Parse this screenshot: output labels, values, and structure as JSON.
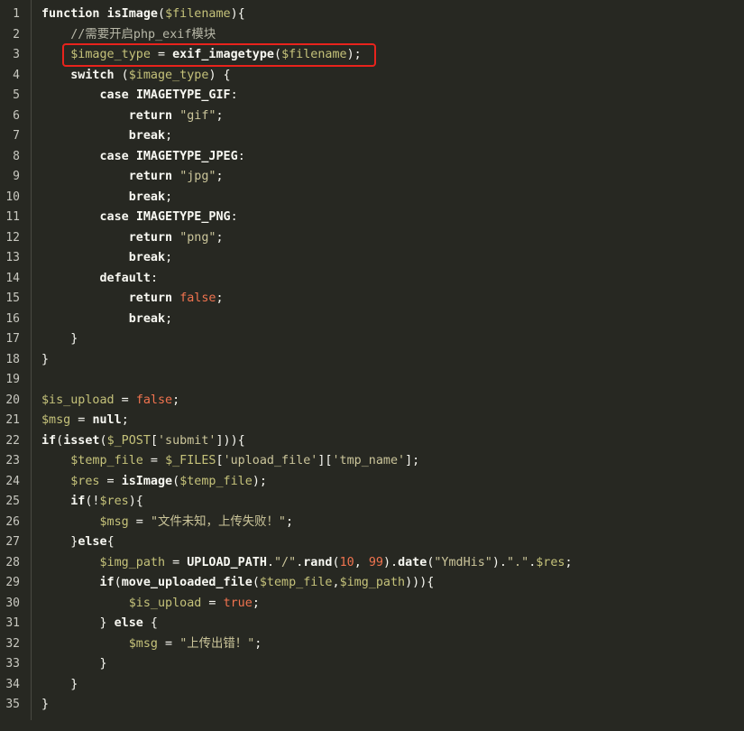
{
  "editor": {
    "highlight_color": "#e8231c",
    "background_color": "#272822",
    "lines": [
      {
        "n": "1",
        "tokens": [
          [
            "kw",
            "function "
          ],
          [
            "fn",
            "isImage"
          ],
          [
            "punc",
            "("
          ],
          [
            "var",
            "$filename"
          ],
          [
            "punc",
            "){"
          ]
        ]
      },
      {
        "n": "2",
        "tokens": [
          [
            "com",
            "    //需要开启php_exif模块"
          ]
        ]
      },
      {
        "n": "3",
        "tokens": [
          [
            "var",
            "    $image_type"
          ],
          [
            "op",
            " = "
          ],
          [
            "fn",
            "exif_imagetype"
          ],
          [
            "punc",
            "("
          ],
          [
            "var",
            "$filename"
          ],
          [
            "punc",
            ");"
          ]
        ]
      },
      {
        "n": "4",
        "tokens": [
          [
            "kw",
            "    switch"
          ],
          [
            "punc",
            " ("
          ],
          [
            "var",
            "$image_type"
          ],
          [
            "punc",
            ") {"
          ]
        ]
      },
      {
        "n": "5",
        "tokens": [
          [
            "kw",
            "        case "
          ],
          [
            "const",
            "IMAGETYPE_GIF"
          ],
          [
            "punc",
            ":"
          ]
        ]
      },
      {
        "n": "6",
        "tokens": [
          [
            "kw",
            "            return "
          ],
          [
            "str",
            "\"gif\""
          ],
          [
            "punc",
            ";"
          ]
        ]
      },
      {
        "n": "7",
        "tokens": [
          [
            "kw",
            "            break"
          ],
          [
            "punc",
            ";"
          ]
        ]
      },
      {
        "n": "8",
        "tokens": [
          [
            "kw",
            "        case "
          ],
          [
            "const",
            "IMAGETYPE_JPEG"
          ],
          [
            "punc",
            ":"
          ]
        ]
      },
      {
        "n": "9",
        "tokens": [
          [
            "kw",
            "            return "
          ],
          [
            "str",
            "\"jpg\""
          ],
          [
            "punc",
            ";"
          ]
        ]
      },
      {
        "n": "10",
        "tokens": [
          [
            "kw",
            "            break"
          ],
          [
            "punc",
            ";"
          ]
        ]
      },
      {
        "n": "11",
        "tokens": [
          [
            "kw",
            "        case "
          ],
          [
            "const",
            "IMAGETYPE_PNG"
          ],
          [
            "punc",
            ":"
          ]
        ]
      },
      {
        "n": "12",
        "tokens": [
          [
            "kw",
            "            return "
          ],
          [
            "str",
            "\"png\""
          ],
          [
            "punc",
            ";"
          ]
        ]
      },
      {
        "n": "13",
        "tokens": [
          [
            "kw",
            "            break"
          ],
          [
            "punc",
            ";"
          ]
        ]
      },
      {
        "n": "14",
        "tokens": [
          [
            "kw",
            "        default"
          ],
          [
            "punc",
            ":"
          ]
        ]
      },
      {
        "n": "15",
        "tokens": [
          [
            "kw",
            "            return "
          ],
          [
            "bool",
            "false"
          ],
          [
            "punc",
            ";"
          ]
        ]
      },
      {
        "n": "16",
        "tokens": [
          [
            "kw",
            "            break"
          ],
          [
            "punc",
            ";"
          ]
        ]
      },
      {
        "n": "17",
        "tokens": [
          [
            "punc",
            "    }"
          ]
        ]
      },
      {
        "n": "18",
        "tokens": [
          [
            "punc",
            "}"
          ]
        ]
      },
      {
        "n": "19",
        "tokens": []
      },
      {
        "n": "20",
        "tokens": [
          [
            "var",
            "$is_upload"
          ],
          [
            "op",
            " = "
          ],
          [
            "bool",
            "false"
          ],
          [
            "punc",
            ";"
          ]
        ]
      },
      {
        "n": "21",
        "tokens": [
          [
            "var",
            "$msg"
          ],
          [
            "op",
            " = "
          ],
          [
            "kw",
            "null"
          ],
          [
            "punc",
            ";"
          ]
        ]
      },
      {
        "n": "22",
        "tokens": [
          [
            "kw",
            "if"
          ],
          [
            "punc",
            "("
          ],
          [
            "fn",
            "isset"
          ],
          [
            "punc",
            "("
          ],
          [
            "var",
            "$_POST"
          ],
          [
            "punc",
            "["
          ],
          [
            "str",
            "'submit'"
          ],
          [
            "punc",
            "])){"
          ]
        ]
      },
      {
        "n": "23",
        "tokens": [
          [
            "var",
            "    $temp_file"
          ],
          [
            "op",
            " = "
          ],
          [
            "var",
            "$_FILES"
          ],
          [
            "punc",
            "["
          ],
          [
            "str",
            "'upload_file'"
          ],
          [
            "punc",
            "]["
          ],
          [
            "str",
            "'tmp_name'"
          ],
          [
            "punc",
            "];"
          ]
        ]
      },
      {
        "n": "24",
        "tokens": [
          [
            "var",
            "    $res"
          ],
          [
            "op",
            " = "
          ],
          [
            "fn",
            "isImage"
          ],
          [
            "punc",
            "("
          ],
          [
            "var",
            "$temp_file"
          ],
          [
            "punc",
            ");"
          ]
        ]
      },
      {
        "n": "25",
        "tokens": [
          [
            "kw",
            "    if"
          ],
          [
            "punc",
            "(!"
          ],
          [
            "var",
            "$res"
          ],
          [
            "punc",
            "){"
          ]
        ]
      },
      {
        "n": "26",
        "tokens": [
          [
            "var",
            "        $msg"
          ],
          [
            "op",
            " = "
          ],
          [
            "str",
            "\"文件未知，上传失败！\""
          ],
          [
            "punc",
            ";"
          ]
        ]
      },
      {
        "n": "27",
        "tokens": [
          [
            "punc",
            "    }"
          ],
          [
            "kw",
            "else"
          ],
          [
            "punc",
            "{"
          ]
        ]
      },
      {
        "n": "28",
        "tokens": [
          [
            "var",
            "        $img_path"
          ],
          [
            "op",
            " = "
          ],
          [
            "const",
            "UPLOAD_PATH"
          ],
          [
            "punc",
            "."
          ],
          [
            "str",
            "\"/\""
          ],
          [
            "punc",
            "."
          ],
          [
            "fn",
            "rand"
          ],
          [
            "punc",
            "("
          ],
          [
            "num",
            "10"
          ],
          [
            "punc",
            ", "
          ],
          [
            "num",
            "99"
          ],
          [
            "punc",
            ")."
          ],
          [
            "fn",
            "date"
          ],
          [
            "punc",
            "("
          ],
          [
            "str",
            "\"YmdHis\""
          ],
          [
            "punc",
            ")."
          ],
          [
            "str",
            "\".\""
          ],
          [
            "punc",
            "."
          ],
          [
            "var",
            "$res"
          ],
          [
            "punc",
            ";"
          ]
        ]
      },
      {
        "n": "29",
        "tokens": [
          [
            "kw",
            "        if"
          ],
          [
            "punc",
            "("
          ],
          [
            "fn",
            "move_uploaded_file"
          ],
          [
            "punc",
            "("
          ],
          [
            "var",
            "$temp_file"
          ],
          [
            "punc",
            ","
          ],
          [
            "var",
            "$img_path"
          ],
          [
            "punc",
            "))){"
          ]
        ]
      },
      {
        "n": "30",
        "tokens": [
          [
            "var",
            "            $is_upload"
          ],
          [
            "op",
            " = "
          ],
          [
            "bool",
            "true"
          ],
          [
            "punc",
            ";"
          ]
        ]
      },
      {
        "n": "31",
        "tokens": [
          [
            "punc",
            "        } "
          ],
          [
            "kw",
            "else"
          ],
          [
            "punc",
            " {"
          ]
        ]
      },
      {
        "n": "32",
        "tokens": [
          [
            "var",
            "            $msg"
          ],
          [
            "op",
            " = "
          ],
          [
            "str",
            "\"上传出错！\""
          ],
          [
            "punc",
            ";"
          ]
        ]
      },
      {
        "n": "33",
        "tokens": [
          [
            "punc",
            "        }"
          ]
        ]
      },
      {
        "n": "34",
        "tokens": [
          [
            "punc",
            "    }"
          ]
        ]
      },
      {
        "n": "35",
        "tokens": [
          [
            "punc",
            "}"
          ]
        ]
      }
    ]
  }
}
